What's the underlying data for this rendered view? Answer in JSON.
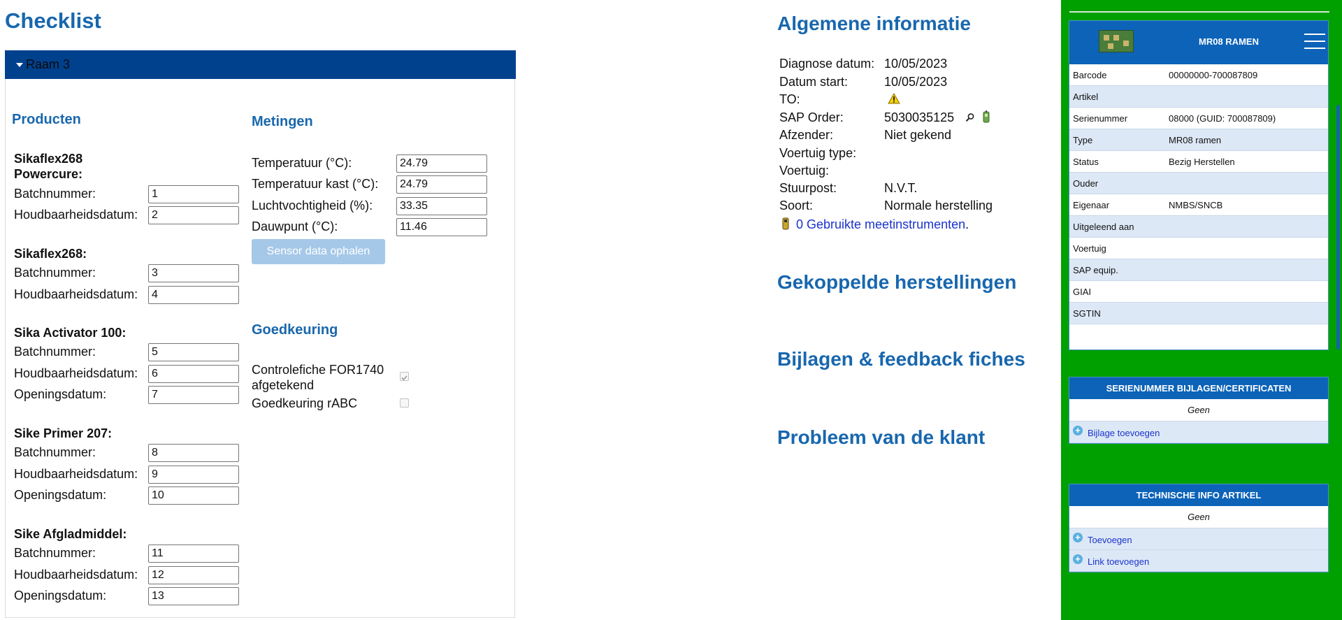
{
  "checklist": {
    "title": "Checklist",
    "raam": "Raam 3",
    "products_title": "Producten",
    "products": [
      {
        "name": "Sikaflex268 Powercure:",
        "fields": [
          {
            "label": "Batchnummer:",
            "value": "1"
          },
          {
            "label": "Houdbaarheidsdatum:",
            "value": "2"
          }
        ]
      },
      {
        "name": "Sikaflex268:",
        "fields": [
          {
            "label": "Batchnummer:",
            "value": "3"
          },
          {
            "label": "Houdbaarheidsdatum:",
            "value": "4"
          }
        ]
      },
      {
        "name": "Sika Activator 100:",
        "fields": [
          {
            "label": "Batchnummer:",
            "value": "5"
          },
          {
            "label": "Houdbaarheidsdatum:",
            "value": "6"
          },
          {
            "label": "Openingsdatum:",
            "value": "7"
          }
        ]
      },
      {
        "name": "Sike Primer 207:",
        "fields": [
          {
            "label": "Batchnummer:",
            "value": "8"
          },
          {
            "label": "Houdbaarheidsdatum:",
            "value": "9"
          },
          {
            "label": "Openingsdatum:",
            "value": "10"
          }
        ]
      },
      {
        "name": "Sike Afgladmiddel:",
        "fields": [
          {
            "label": "Batchnummer:",
            "value": "11"
          },
          {
            "label": "Houdbaarheidsdatum:",
            "value": "12"
          },
          {
            "label": "Openingsdatum:",
            "value": "13"
          }
        ]
      }
    ],
    "metingen_title": "Metingen",
    "metingen": [
      {
        "label": "Temperatuur (°C):",
        "value": "24.79"
      },
      {
        "label": "Temperatuur kast (°C):",
        "value": "24.79"
      },
      {
        "label": "Luchtvochtigheid (%):",
        "value": "33.35"
      },
      {
        "label": "Dauwpunt (°C):",
        "value": "11.46"
      }
    ],
    "sensor_button": "Sensor data ophalen",
    "goedkeuring_title": "Goedkeuring",
    "goedkeuring": [
      {
        "label": "Controlefiche FOR1740 afgetekend",
        "checked": true,
        "disabled": true
      },
      {
        "label": "Goedkeuring rABC",
        "checked": false,
        "disabled": true
      }
    ]
  },
  "info": {
    "title": "Algemene informatie",
    "rows": [
      {
        "label": "Diagnose datum:",
        "value": "10/05/2023"
      },
      {
        "label": "Datum start:",
        "value": "10/05/2023"
      },
      {
        "label": "TO:",
        "value": ""
      },
      {
        "label": "SAP Order:",
        "value": "5030035125"
      },
      {
        "label": "Afzender:",
        "value": "Niet gekend"
      },
      {
        "label": "Voertuig type:",
        "value": ""
      },
      {
        "label": "Voertuig:",
        "value": ""
      },
      {
        "label": "Stuurpost:",
        "value": "N.V.T."
      },
      {
        "label": "Soort:",
        "value": "Normale herstelling"
      }
    ],
    "instruments_link": "0 Gebruikte meetinstrumenten",
    "instruments_period": ".",
    "sections": [
      "Gekoppelde herstellingen",
      "Bijlagen & feedback fiches",
      "Probleem van de klant"
    ]
  },
  "article": {
    "name": "MR08 RAMEN",
    "rows": [
      {
        "label": "Barcode",
        "value": "00000000-700087809"
      },
      {
        "label": "Artikel",
        "value": ""
      },
      {
        "label": "Serienummer",
        "value": "08000 (GUID: 700087809)"
      },
      {
        "label": "Type",
        "value": "MR08 ramen"
      },
      {
        "label": "Status",
        "value": "Bezig Herstellen"
      },
      {
        "label": "Ouder",
        "value": ""
      },
      {
        "label": "Eigenaar",
        "value": "NMBS/SNCB"
      },
      {
        "label": "Uitgeleend aan",
        "value": ""
      },
      {
        "label": "Voertuig",
        "value": ""
      },
      {
        "label": "SAP equip.",
        "value": ""
      },
      {
        "label": "GIAI",
        "value": ""
      },
      {
        "label": "SGTIN",
        "value": ""
      }
    ]
  },
  "attachments": {
    "title": "SERIENUMMER BIJLAGEN/CERTIFICATEN",
    "empty": "Geen",
    "add": "Bijlage toevoegen"
  },
  "tech_info": {
    "title": "TECHNISCHE INFO ARTIKEL",
    "empty": "Geen",
    "add": "Toevoegen",
    "add_link": "Link toevoegen"
  },
  "colors": {
    "brand_blue": "#1867ad",
    "bar_blue": "#00418e",
    "panel_green": "#00a000",
    "header_blue": "#0c63b8"
  }
}
